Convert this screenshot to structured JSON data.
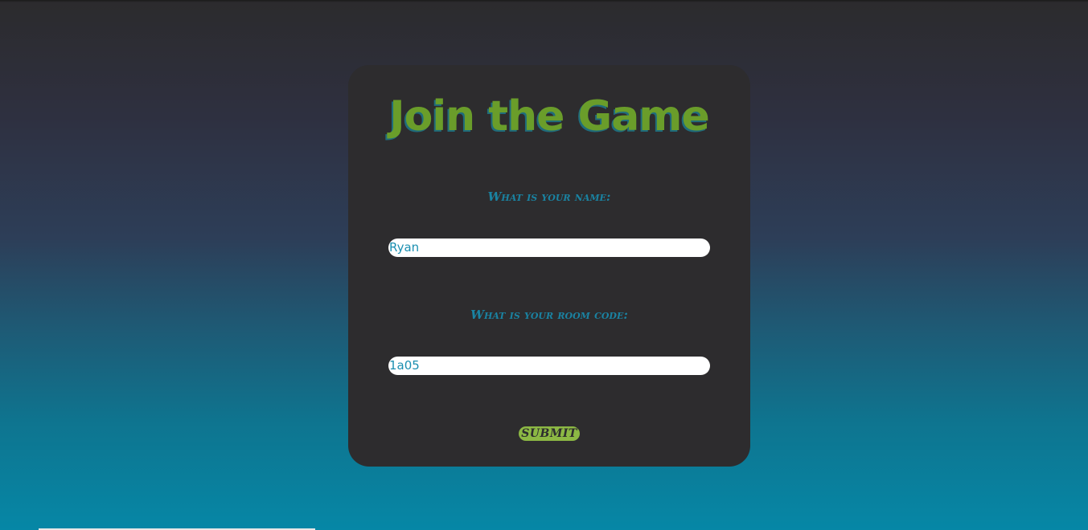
{
  "form": {
    "title": "Join the Game",
    "name_label": "What is your name:",
    "name_value": "Ryan",
    "code_label": "What is your room code:",
    "code_value": "1a05",
    "submit_label": "SUBMIT"
  },
  "colors": {
    "card_background": "#2d2c2e",
    "title_green": "#6a9d2a",
    "label_blue": "#1a83a2",
    "button_green": "#8cb844",
    "gradient_top": "#2c2b2d",
    "gradient_bottom": "#0687a6"
  }
}
